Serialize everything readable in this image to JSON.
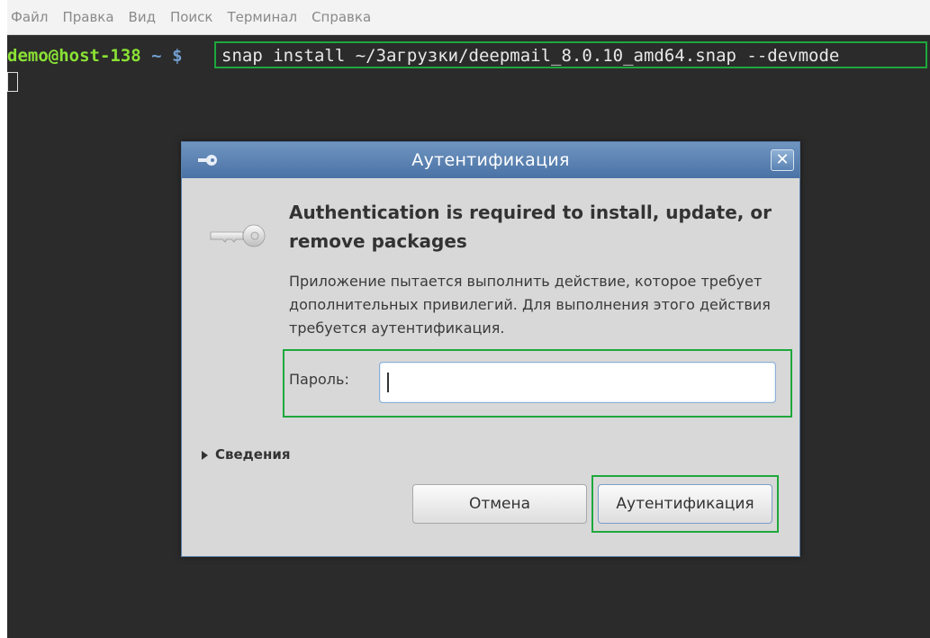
{
  "menubar": {
    "items": [
      "Файл",
      "Правка",
      "Вид",
      "Поиск",
      "Терминал",
      "Справка"
    ]
  },
  "terminal": {
    "user_host": "demo@host-138",
    "path": "~",
    "prompt_symbol": "$",
    "command": "snap install ~/Загрузки/deepmail_8.0.10_amd64.snap --devmode",
    "colors": {
      "background": "#2b2b2b",
      "user_host": "#8ae234",
      "path": "#729fcf",
      "highlight": "#1ea83c"
    }
  },
  "dialog": {
    "title": "Аутентификация",
    "close_glyph": "✕",
    "heading": "Authentication is required to install, update, or remove packages",
    "description": "Приложение пытается выполнить действие, которое требует дополнительных привилегий. Для выполнения этого действия требуется аутентификация.",
    "password_label": "Пароль:",
    "password_value": "",
    "details_label": "Сведения",
    "cancel_label": "Отмена",
    "auth_label": "Аутентификация",
    "icons": {
      "title": "key-icon",
      "main": "key-icon",
      "details": "triangle-right-icon"
    }
  }
}
